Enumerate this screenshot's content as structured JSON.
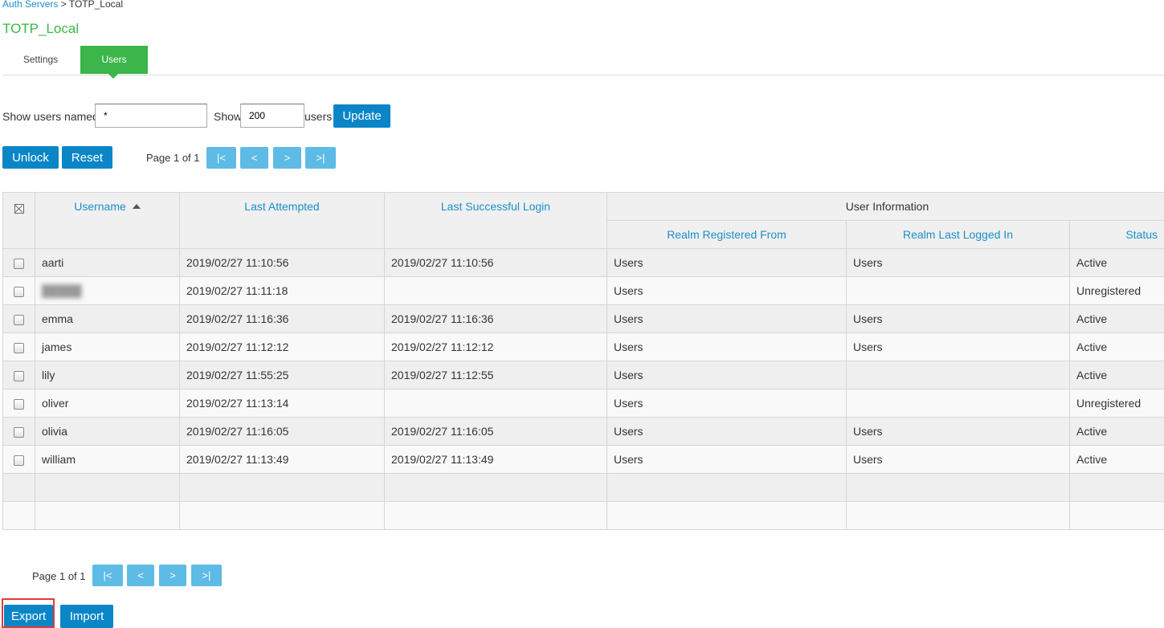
{
  "breadcrumb": {
    "parent": "Auth Servers",
    "separator": " > ",
    "current": "TOTP_Local"
  },
  "page_title": "TOTP_Local",
  "tabs": [
    {
      "label": "Settings",
      "active": false
    },
    {
      "label": "Users",
      "active": true
    }
  ],
  "filter": {
    "show_users_named_label": "Show users named:",
    "name_value": "*",
    "show_label": "Show",
    "count_value": "200",
    "users_label": "users",
    "update_label": "Update"
  },
  "actions": {
    "unlock_label": "Unlock",
    "reset_label": "Reset"
  },
  "pager": {
    "page_info": "Page 1 of 1",
    "first": "|<",
    "prev": "<",
    "next": ">",
    "last": ">|"
  },
  "table": {
    "headers": {
      "username": "Username",
      "last_attempted": "Last Attempted",
      "last_successful_login": "Last Successful Login",
      "user_information": "User Information",
      "realm_registered_from": "Realm Registered From",
      "realm_last_logged_in": "Realm Last Logged In",
      "status": "Status"
    },
    "sort": {
      "column": "username",
      "direction": "ascending"
    },
    "rows": [
      {
        "username": "aarti",
        "last_attempted": "2019/02/27 11:10:56",
        "last_success": "2019/02/27 11:10:56",
        "realm_registered": "Users",
        "realm_last": "Users",
        "status": "Active"
      },
      {
        "username": "",
        "last_attempted": "2019/02/27 11:11:18",
        "last_success": "",
        "realm_registered": "Users",
        "realm_last": "",
        "status": "Unregistered"
      },
      {
        "username": "emma",
        "last_attempted": "2019/02/27 11:16:36",
        "last_success": "2019/02/27 11:16:36",
        "realm_registered": "Users",
        "realm_last": "Users",
        "status": "Active"
      },
      {
        "username": "james",
        "last_attempted": "2019/02/27 11:12:12",
        "last_success": "2019/02/27 11:12:12",
        "realm_registered": "Users",
        "realm_last": "Users",
        "status": "Active"
      },
      {
        "username": "lily",
        "last_attempted": "2019/02/27 11:55:25",
        "last_success": "2019/02/27 11:12:55",
        "realm_registered": "Users",
        "realm_last": "",
        "status": "Active"
      },
      {
        "username": "oliver",
        "last_attempted": "2019/02/27 11:13:14",
        "last_success": "",
        "realm_registered": "Users",
        "realm_last": "",
        "status": "Unregistered"
      },
      {
        "username": "olivia",
        "last_attempted": "2019/02/27 11:16:05",
        "last_success": "2019/02/27 11:16:05",
        "realm_registered": "Users",
        "realm_last": "Users",
        "status": "Active"
      },
      {
        "username": "william",
        "last_attempted": "2019/02/27 11:13:49",
        "last_success": "2019/02/27 11:13:49",
        "realm_registered": "Users",
        "realm_last": "Users",
        "status": "Active"
      }
    ]
  },
  "footer": {
    "export_label": "Export",
    "import_label": "Import"
  },
  "colors": {
    "accent_green": "#3cb54a",
    "button_blue": "#0a86c7",
    "nav_blue": "#5dbbe6",
    "link_blue": "#1a8fc9",
    "highlight_red": "#e23b3b"
  }
}
